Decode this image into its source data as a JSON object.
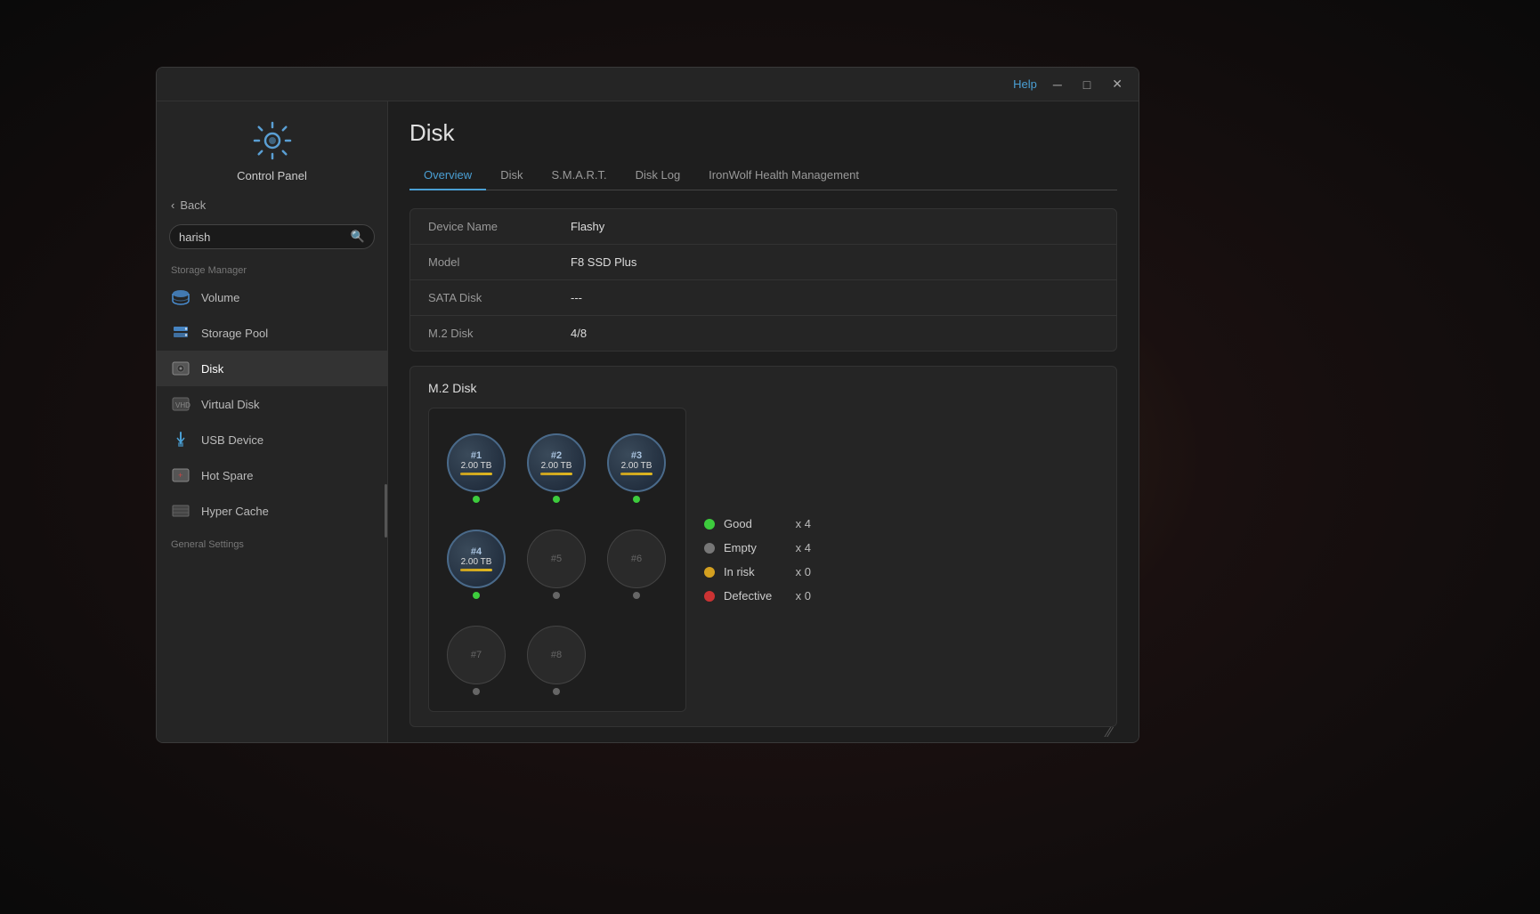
{
  "window": {
    "help_label": "Help",
    "minimize_label": "─",
    "maximize_label": "□",
    "close_label": "✕"
  },
  "sidebar": {
    "app_title": "Control Panel",
    "back_label": "Back",
    "search_value": "harish",
    "search_placeholder": "Search",
    "section_storage": "Storage Manager",
    "section_general": "General Settings",
    "items": [
      {
        "id": "volume",
        "label": "Volume"
      },
      {
        "id": "storage-pool",
        "label": "Storage Pool"
      },
      {
        "id": "disk",
        "label": "Disk"
      },
      {
        "id": "virtual-disk",
        "label": "Virtual Disk"
      },
      {
        "id": "usb-device",
        "label": "USB Device"
      },
      {
        "id": "hot-spare",
        "label": "Hot Spare"
      },
      {
        "id": "hyper-cache",
        "label": "Hyper Cache"
      }
    ]
  },
  "main": {
    "page_title": "Disk",
    "tabs": [
      {
        "id": "overview",
        "label": "Overview"
      },
      {
        "id": "disk",
        "label": "Disk"
      },
      {
        "id": "smart",
        "label": "S.M.A.R.T."
      },
      {
        "id": "disk-log",
        "label": "Disk Log"
      },
      {
        "id": "ironwolf",
        "label": "IronWolf Health Management"
      }
    ],
    "active_tab": "overview",
    "info_rows": [
      {
        "label": "Device Name",
        "value": "Flashy"
      },
      {
        "label": "Model",
        "value": "F8 SSD Plus"
      },
      {
        "label": "SATA Disk",
        "value": "---"
      },
      {
        "label": "M.2 Disk",
        "value": "4/8"
      }
    ],
    "disk_section_title": "M.2 Disk",
    "disk_slots": [
      {
        "id": 1,
        "num": "#1",
        "size": "2.00 TB",
        "filled": true,
        "status": "good"
      },
      {
        "id": 2,
        "num": "#2",
        "size": "2.00 TB",
        "filled": true,
        "status": "good"
      },
      {
        "id": 3,
        "num": "#3",
        "size": "2.00 TB",
        "filled": true,
        "status": "good"
      },
      {
        "id": 4,
        "num": "#4",
        "size": "2.00 TB",
        "filled": true,
        "status": "good"
      },
      {
        "id": 5,
        "num": "#5",
        "size": "",
        "filled": false,
        "status": "empty"
      },
      {
        "id": 6,
        "num": "#6",
        "size": "",
        "filled": false,
        "status": "empty"
      },
      {
        "id": 7,
        "num": "#7",
        "size": "",
        "filled": false,
        "status": "empty"
      },
      {
        "id": 8,
        "num": "#8",
        "size": "",
        "filled": false,
        "status": "empty"
      }
    ],
    "legend": [
      {
        "id": "good",
        "label": "Good",
        "color": "green",
        "count": "x 4"
      },
      {
        "id": "empty",
        "label": "Empty",
        "color": "gray",
        "count": "x 4"
      },
      {
        "id": "in-risk",
        "label": "In risk",
        "color": "yellow",
        "count": "x 0"
      },
      {
        "id": "defective",
        "label": "Defective",
        "color": "red",
        "count": "x 0"
      }
    ]
  }
}
